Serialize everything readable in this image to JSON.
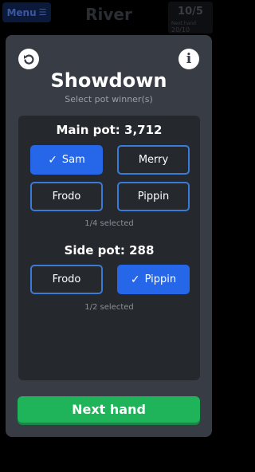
{
  "topbar": {
    "menu_label": "Menu",
    "menu_icon": "☰",
    "street": "River",
    "score": "10/5",
    "hands_label": "Next hand",
    "hands_count": "20/10"
  },
  "modal": {
    "back_icon": "↺",
    "info_icon": "i",
    "title": "Showdown",
    "subtitle": "Select pot winner(s)",
    "pots": [
      {
        "title": "Main pot: 3,712",
        "players": [
          {
            "name": "Sam",
            "selected": true
          },
          {
            "name": "Merry",
            "selected": false
          },
          {
            "name": "Frodo",
            "selected": false
          },
          {
            "name": "Pippin",
            "selected": false
          }
        ],
        "selected_text": "1/4 selected"
      },
      {
        "title": "Side pot: 288",
        "players": [
          {
            "name": "Frodo",
            "selected": false
          },
          {
            "name": "Pippin",
            "selected": true
          }
        ],
        "selected_text": "1/2 selected"
      }
    ],
    "check_icon": "✓",
    "next_label": "Next hand"
  },
  "colors": {
    "accent_blue": "#2667ea",
    "outline_blue": "#3b7bd8",
    "success_green": "#1fb35a",
    "modal_bg": "#383c44",
    "panel_bg": "#25292e"
  }
}
